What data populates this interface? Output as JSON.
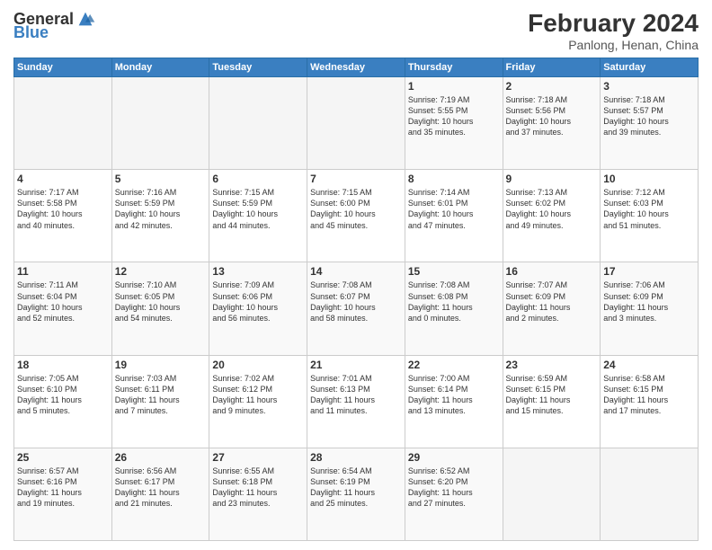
{
  "header": {
    "logo_general": "General",
    "logo_blue": "Blue",
    "title": "February 2024",
    "subtitle": "Panlong, Henan, China"
  },
  "weekdays": [
    "Sunday",
    "Monday",
    "Tuesday",
    "Wednesday",
    "Thursday",
    "Friday",
    "Saturday"
  ],
  "weeks": [
    [
      {
        "day": "",
        "info": ""
      },
      {
        "day": "",
        "info": ""
      },
      {
        "day": "",
        "info": ""
      },
      {
        "day": "",
        "info": ""
      },
      {
        "day": "1",
        "info": "Sunrise: 7:19 AM\nSunset: 5:55 PM\nDaylight: 10 hours\nand 35 minutes."
      },
      {
        "day": "2",
        "info": "Sunrise: 7:18 AM\nSunset: 5:56 PM\nDaylight: 10 hours\nand 37 minutes."
      },
      {
        "day": "3",
        "info": "Sunrise: 7:18 AM\nSunset: 5:57 PM\nDaylight: 10 hours\nand 39 minutes."
      }
    ],
    [
      {
        "day": "4",
        "info": "Sunrise: 7:17 AM\nSunset: 5:58 PM\nDaylight: 10 hours\nand 40 minutes."
      },
      {
        "day": "5",
        "info": "Sunrise: 7:16 AM\nSunset: 5:59 PM\nDaylight: 10 hours\nand 42 minutes."
      },
      {
        "day": "6",
        "info": "Sunrise: 7:15 AM\nSunset: 5:59 PM\nDaylight: 10 hours\nand 44 minutes."
      },
      {
        "day": "7",
        "info": "Sunrise: 7:15 AM\nSunset: 6:00 PM\nDaylight: 10 hours\nand 45 minutes."
      },
      {
        "day": "8",
        "info": "Sunrise: 7:14 AM\nSunset: 6:01 PM\nDaylight: 10 hours\nand 47 minutes."
      },
      {
        "day": "9",
        "info": "Sunrise: 7:13 AM\nSunset: 6:02 PM\nDaylight: 10 hours\nand 49 minutes."
      },
      {
        "day": "10",
        "info": "Sunrise: 7:12 AM\nSunset: 6:03 PM\nDaylight: 10 hours\nand 51 minutes."
      }
    ],
    [
      {
        "day": "11",
        "info": "Sunrise: 7:11 AM\nSunset: 6:04 PM\nDaylight: 10 hours\nand 52 minutes."
      },
      {
        "day": "12",
        "info": "Sunrise: 7:10 AM\nSunset: 6:05 PM\nDaylight: 10 hours\nand 54 minutes."
      },
      {
        "day": "13",
        "info": "Sunrise: 7:09 AM\nSunset: 6:06 PM\nDaylight: 10 hours\nand 56 minutes."
      },
      {
        "day": "14",
        "info": "Sunrise: 7:08 AM\nSunset: 6:07 PM\nDaylight: 10 hours\nand 58 minutes."
      },
      {
        "day": "15",
        "info": "Sunrise: 7:08 AM\nSunset: 6:08 PM\nDaylight: 11 hours\nand 0 minutes."
      },
      {
        "day": "16",
        "info": "Sunrise: 7:07 AM\nSunset: 6:09 PM\nDaylight: 11 hours\nand 2 minutes."
      },
      {
        "day": "17",
        "info": "Sunrise: 7:06 AM\nSunset: 6:09 PM\nDaylight: 11 hours\nand 3 minutes."
      }
    ],
    [
      {
        "day": "18",
        "info": "Sunrise: 7:05 AM\nSunset: 6:10 PM\nDaylight: 11 hours\nand 5 minutes."
      },
      {
        "day": "19",
        "info": "Sunrise: 7:03 AM\nSunset: 6:11 PM\nDaylight: 11 hours\nand 7 minutes."
      },
      {
        "day": "20",
        "info": "Sunrise: 7:02 AM\nSunset: 6:12 PM\nDaylight: 11 hours\nand 9 minutes."
      },
      {
        "day": "21",
        "info": "Sunrise: 7:01 AM\nSunset: 6:13 PM\nDaylight: 11 hours\nand 11 minutes."
      },
      {
        "day": "22",
        "info": "Sunrise: 7:00 AM\nSunset: 6:14 PM\nDaylight: 11 hours\nand 13 minutes."
      },
      {
        "day": "23",
        "info": "Sunrise: 6:59 AM\nSunset: 6:15 PM\nDaylight: 11 hours\nand 15 minutes."
      },
      {
        "day": "24",
        "info": "Sunrise: 6:58 AM\nSunset: 6:15 PM\nDaylight: 11 hours\nand 17 minutes."
      }
    ],
    [
      {
        "day": "25",
        "info": "Sunrise: 6:57 AM\nSunset: 6:16 PM\nDaylight: 11 hours\nand 19 minutes."
      },
      {
        "day": "26",
        "info": "Sunrise: 6:56 AM\nSunset: 6:17 PM\nDaylight: 11 hours\nand 21 minutes."
      },
      {
        "day": "27",
        "info": "Sunrise: 6:55 AM\nSunset: 6:18 PM\nDaylight: 11 hours\nand 23 minutes."
      },
      {
        "day": "28",
        "info": "Sunrise: 6:54 AM\nSunset: 6:19 PM\nDaylight: 11 hours\nand 25 minutes."
      },
      {
        "day": "29",
        "info": "Sunrise: 6:52 AM\nSunset: 6:20 PM\nDaylight: 11 hours\nand 27 minutes."
      },
      {
        "day": "",
        "info": ""
      },
      {
        "day": "",
        "info": ""
      }
    ]
  ]
}
